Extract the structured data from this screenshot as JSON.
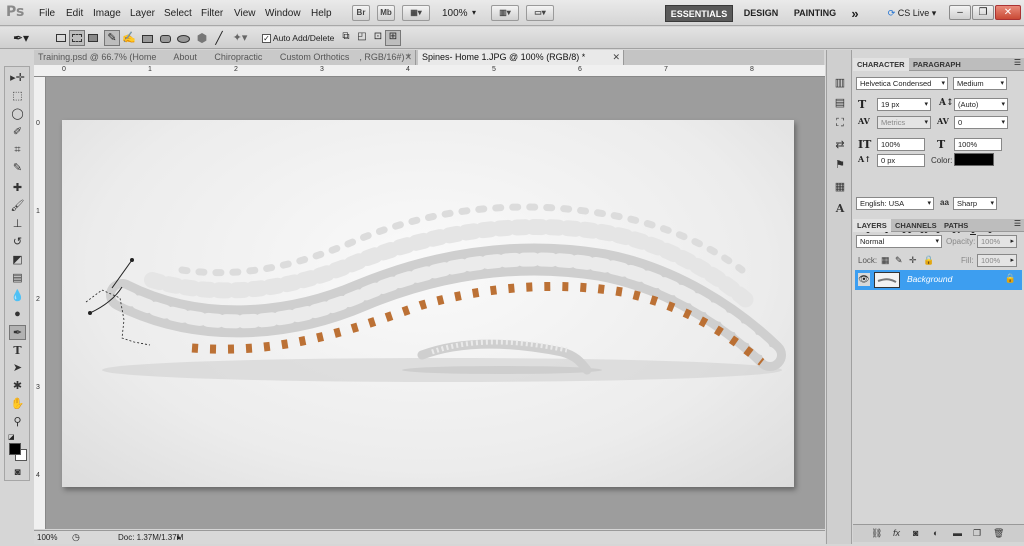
{
  "app": {
    "logo": "Ps"
  },
  "menu": [
    "File",
    "Edit",
    "Image",
    "Layer",
    "Select",
    "Filter",
    "View",
    "Window",
    "Help"
  ],
  "appbar": {
    "bridge": "Br",
    "mini_bridge": "Mb",
    "zoom": "100%"
  },
  "workspaces": [
    "ESSENTIALS",
    "DESIGN",
    "PAINTING"
  ],
  "more_workspaces": "»",
  "cslive": "CS Live",
  "options_bar": {
    "auto_add_delete_label": "Auto Add/Delete",
    "auto_add_delete_checked": true
  },
  "tabs": [
    {
      "label": "Training.psd @ 66.7% (Home       About       Chiropractic       Custom Orthotics    , RGB/16#) *",
      "active": false
    },
    {
      "label": "Spines- Home 1.JPG @ 100% (RGB/8) *",
      "active": true
    }
  ],
  "ruler_top": [
    "0",
    "1",
    "2",
    "3",
    "4",
    "5",
    "6",
    "7",
    "8"
  ],
  "ruler_left": [
    "0",
    "1",
    "2",
    "3",
    "4"
  ],
  "status": {
    "zoom": "100%",
    "doc": "Doc: 1.37M/1.37M"
  },
  "character_panel": {
    "tabs": [
      "CHARACTER",
      "PARAGRAPH"
    ],
    "font_family": "Helvetica Condensed",
    "font_style": "Medium",
    "font_size": "19 px",
    "leading": "(Auto)",
    "kerning": "Metrics",
    "tracking": "0",
    "vertical_scale": "100%",
    "horizontal_scale": "100%",
    "baseline_shift": "0 px",
    "color_label": "Color:",
    "text_color": "#000000",
    "format_buttons": [
      "T",
      "T",
      "TT",
      "Tr",
      "T¹",
      "T₁",
      "T",
      "Ŧ"
    ],
    "language": "English: USA",
    "aa_icon": "aa",
    "antialias": "Sharp"
  },
  "layers_panel": {
    "tabs": [
      "LAYERS",
      "CHANNELS",
      "PATHS"
    ],
    "blend_mode": "Normal",
    "opacity_label": "Opacity:",
    "opacity": "100%",
    "lock_label": "Lock:",
    "fill_label": "Fill:",
    "fill": "100%",
    "layers": [
      {
        "name": "Background",
        "selected": true,
        "visible": true,
        "locked": true
      }
    ]
  }
}
